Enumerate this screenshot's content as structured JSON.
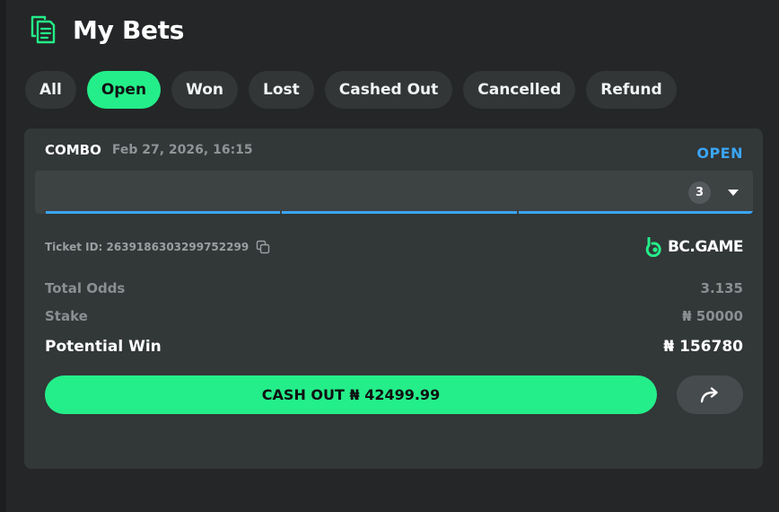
{
  "header": {
    "title": "My Bets",
    "icon": "bet-slip-icon"
  },
  "tabs": [
    {
      "label": "All",
      "active": false
    },
    {
      "label": "Open",
      "active": true
    },
    {
      "label": "Won",
      "active": false
    },
    {
      "label": "Lost",
      "active": false
    },
    {
      "label": "Cashed Out",
      "active": false
    },
    {
      "label": "Cancelled",
      "active": false
    },
    {
      "label": "Refund",
      "active": false
    }
  ],
  "bet": {
    "type": "COMBO",
    "datetime": "Feb 27, 2026, 16:15",
    "status": "OPEN",
    "legs_count": "3",
    "ticket_id": "Ticket ID: 2639186303299752299",
    "brand": "BC.GAME",
    "total_odds_label": "Total Odds",
    "total_odds_value": "3.135",
    "stake_label": "Stake",
    "stake_value": "₦ 50000",
    "potential_win_label": "Potential Win",
    "potential_win_value": "₦ 156780",
    "cashout_label": "CASH OUT ₦ 42499.99"
  },
  "colors": {
    "accent": "#24ee89",
    "status_open": "#3aa5f5",
    "background": "#242627",
    "card": "#323738"
  }
}
